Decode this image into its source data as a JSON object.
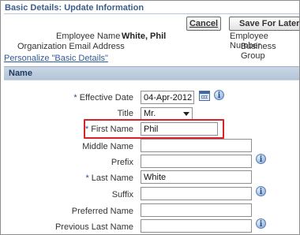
{
  "header": {
    "title": "Basic Details: Update Information",
    "cancel_label": "Cancel",
    "save_label": "Save For Later"
  },
  "employee": {
    "name_label": "Employee Name",
    "name_value": "White, Phil",
    "number_label": "Employee Number",
    "org_email_label": "Organization Email Address",
    "business_group_label": "Business Group"
  },
  "personalize_link": "Personalize \"Basic Details\"",
  "section": {
    "title": "Name"
  },
  "fields": {
    "effective_date": {
      "label": "Effective Date",
      "value": "04-Apr-2012",
      "required": "*"
    },
    "title": {
      "label": "Title",
      "value": "Mr."
    },
    "first_name": {
      "label": "First Name",
      "value": "Phil",
      "required": "*"
    },
    "middle_name": {
      "label": "Middle Name",
      "value": ""
    },
    "prefix": {
      "label": "Prefix",
      "value": ""
    },
    "last_name": {
      "label": "Last Name",
      "value": "White",
      "required": "*"
    },
    "suffix": {
      "label": "Suffix",
      "value": ""
    },
    "preferred_name": {
      "label": "Preferred Name",
      "value": ""
    },
    "previous_last_name": {
      "label": "Previous Last Name",
      "value": ""
    }
  },
  "icons": {
    "info": "info-icon",
    "calendar": "calendar-icon",
    "info_glyph": "i"
  },
  "colors": {
    "highlight": "#d8232a",
    "section_bar": "#c9d6e4",
    "link": "#2d5b9a"
  }
}
